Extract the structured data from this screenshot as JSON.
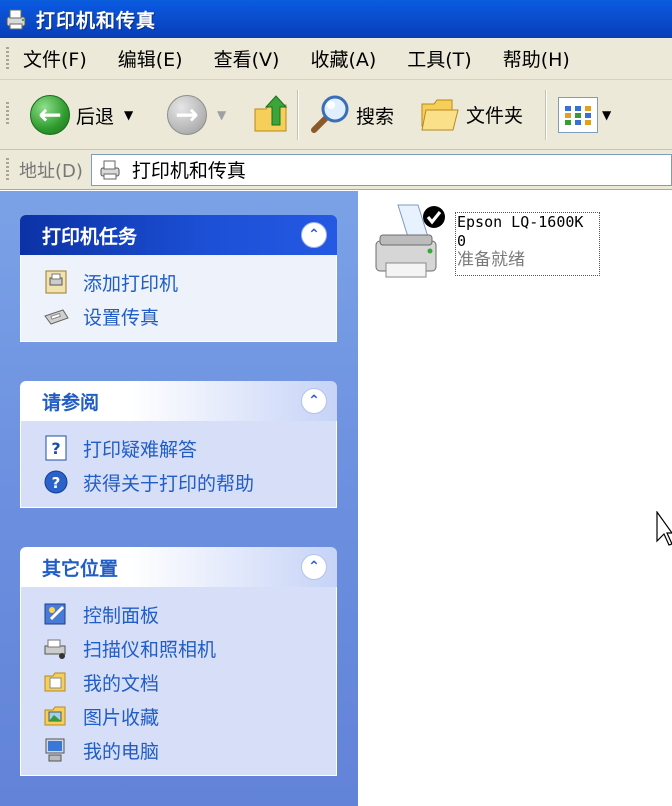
{
  "window": {
    "title": "打印机和传真"
  },
  "menu": [
    "文件(F)",
    "编辑(E)",
    "查看(V)",
    "收藏(A)",
    "工具(T)",
    "帮助(H)"
  ],
  "toolbar": {
    "back": "后退",
    "search": "搜索",
    "folders": "文件夹"
  },
  "address": {
    "label": "地址(D)",
    "value": "打印机和传真"
  },
  "panels": {
    "printer_tasks": {
      "title": "打印机任务",
      "items": [
        "添加打印机",
        "设置传真"
      ]
    },
    "see_also": {
      "title": "请参阅",
      "items": [
        "打印疑难解答",
        "获得关于打印的帮助"
      ]
    },
    "other_places": {
      "title": "其它位置",
      "items": [
        "控制面板",
        "扫描仪和照相机",
        "我的文档",
        "图片收藏",
        "我的电脑"
      ]
    }
  },
  "printer": {
    "name": "Epson LQ-1600K",
    "docs": "0",
    "status": "准备就绪"
  },
  "colors": {
    "titlebar": "#0a4fd0",
    "pane": "#6f93e0",
    "link": "#215dc6"
  }
}
